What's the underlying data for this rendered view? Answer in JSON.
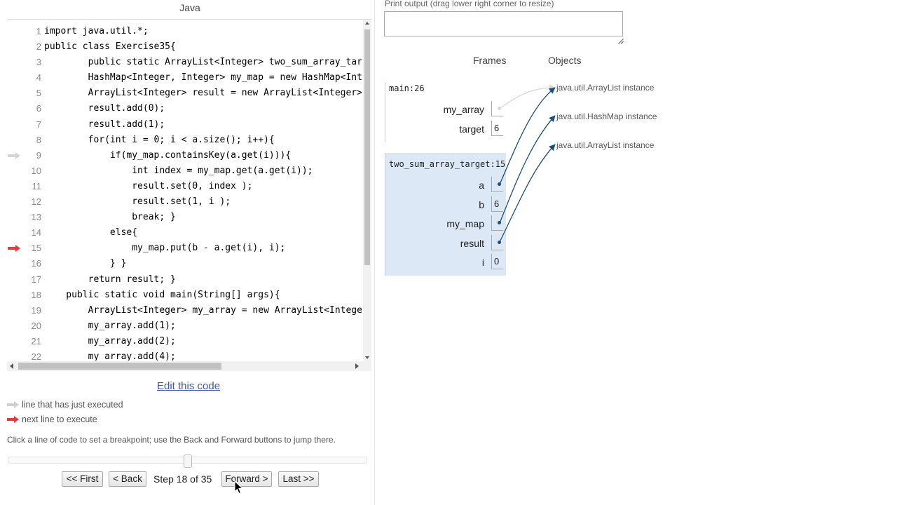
{
  "editor": {
    "language": "Java",
    "lines": [
      {
        "no": "1",
        "code": "import java.util.*;",
        "marker": ""
      },
      {
        "no": "2",
        "code": "public class Exercise35{",
        "marker": ""
      },
      {
        "no": "3",
        "code": "        public static ArrayList<Integer> two_sum_array_targe",
        "marker": ""
      },
      {
        "no": "4",
        "code": "        HashMap<Integer, Integer> my_map = new HashMap<Integ",
        "marker": ""
      },
      {
        "no": "5",
        "code": "        ArrayList<Integer> result = new ArrayList<Integer>(",
        "marker": ""
      },
      {
        "no": "6",
        "code": "        result.add(0);",
        "marker": ""
      },
      {
        "no": "7",
        "code": "        result.add(1);",
        "marker": ""
      },
      {
        "no": "8",
        "code": "        for(int i = 0; i < a.size(); i++){",
        "marker": ""
      },
      {
        "no": "9",
        "code": "            if(my_map.containsKey(a.get(i))){",
        "marker": "just"
      },
      {
        "no": "10",
        "code": "                int index = my_map.get(a.get(i));",
        "marker": ""
      },
      {
        "no": "11",
        "code": "                result.set(0, index );",
        "marker": ""
      },
      {
        "no": "12",
        "code": "                result.set(1, i );",
        "marker": ""
      },
      {
        "no": "13",
        "code": "                break; }",
        "marker": ""
      },
      {
        "no": "14",
        "code": "            else{",
        "marker": ""
      },
      {
        "no": "15",
        "code": "                my_map.put(b - a.get(i), i);",
        "marker": "next"
      },
      {
        "no": "16",
        "code": "            } }",
        "marker": ""
      },
      {
        "no": "17",
        "code": "        return result; }",
        "marker": ""
      },
      {
        "no": "18",
        "code": "    public static void main(String[] args){",
        "marker": ""
      },
      {
        "no": "19",
        "code": "        ArrayList<Integer> my_array = new ArrayList<Integer>",
        "marker": ""
      },
      {
        "no": "20",
        "code": "        my_array.add(1);",
        "marker": ""
      },
      {
        "no": "21",
        "code": "        my_array.add(2);",
        "marker": ""
      },
      {
        "no": "22",
        "code": "        my_array.add(4);",
        "marker": ""
      }
    ]
  },
  "edit_link": "Edit this code",
  "legend": {
    "just_executed": "line that has just executed",
    "next_to_execute": "next line to execute"
  },
  "hint": "Click a line of code to set a breakpoint; use the Back and Forward buttons to jump there.",
  "navigation": {
    "first": "<< First",
    "back": "< Back",
    "step": "Step 18 of 35",
    "forward": "Forward >",
    "last": "Last >>",
    "step_current": 18,
    "step_total": 35
  },
  "print_output": {
    "label": "Print output (drag lower right corner to resize)",
    "value": ""
  },
  "visualizer": {
    "frames_header": "Frames",
    "objects_header": "Objects",
    "frames": [
      {
        "title": "main:26",
        "active": false,
        "vars": [
          {
            "name": "my_array",
            "value": "",
            "pointer": true,
            "faded": true
          },
          {
            "name": "target",
            "value": "6",
            "pointer": false
          }
        ]
      },
      {
        "title": "two_sum_array_target:15",
        "active": true,
        "vars": [
          {
            "name": "a",
            "value": "",
            "pointer": true
          },
          {
            "name": "b",
            "value": "6",
            "pointer": false
          },
          {
            "name": "my_map",
            "value": "",
            "pointer": true
          },
          {
            "name": "result",
            "value": "",
            "pointer": true
          },
          {
            "name": "i",
            "value": "0",
            "pointer": false
          }
        ]
      }
    ],
    "objects": [
      {
        "label": "java.util.ArrayList instance"
      },
      {
        "label": "java.util.HashMap instance"
      },
      {
        "label": "java.util.ArrayList instance"
      }
    ]
  },
  "colors": {
    "pointer": "#1d4f7a",
    "faded_pointer": "#d8d8d8",
    "active_frame": "#dde8f6",
    "next_arrow": "#e03a3a",
    "just_arrow": "#d5d5d5",
    "link": "#3d58a6"
  }
}
